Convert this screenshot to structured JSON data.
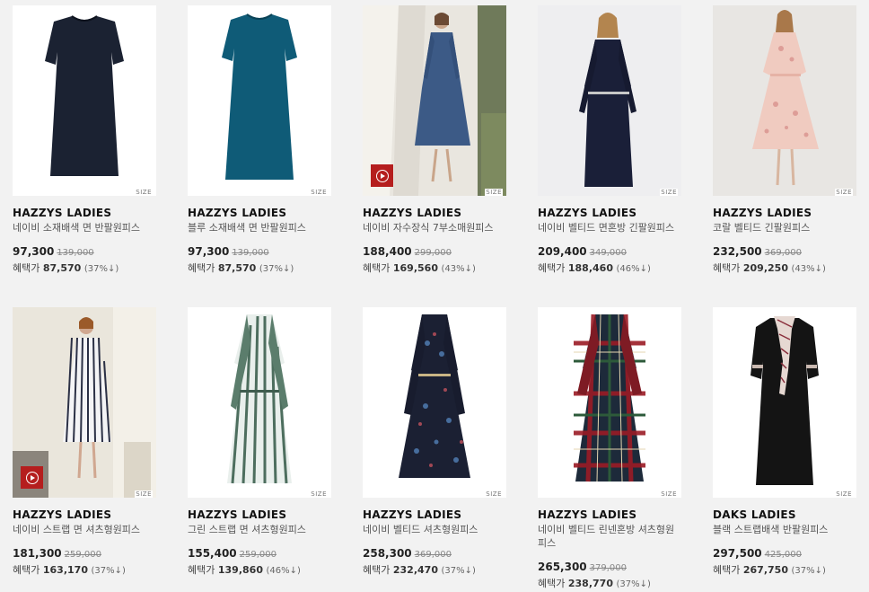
{
  "size_label": "SIZE",
  "benefit_label": "혜택가",
  "products": [
    {
      "brand": "HAZZYS LADIES",
      "name": "네이비 소재배색 면 반팔원피스",
      "price": "97,300",
      "original_price": "139,000",
      "benefit_price": "87,570",
      "discount": "(37%↓)",
      "video": false,
      "image": "navy-short-sleeve-dress"
    },
    {
      "brand": "HAZZYS LADIES",
      "name": "블루 소재배색 면 반팔원피스",
      "price": "97,300",
      "original_price": "139,000",
      "benefit_price": "87,570",
      "discount": "(37%↓)",
      "video": false,
      "image": "teal-short-sleeve-dress"
    },
    {
      "brand": "HAZZYS LADIES",
      "name": "네이비 자수장식 7부소매원피스",
      "price": "188,400",
      "original_price": "299,000",
      "benefit_price": "169,560",
      "discount": "(43%↓)",
      "video": true,
      "image": "model-blue-dress-curtain"
    },
    {
      "brand": "HAZZYS LADIES",
      "name": "네이비 벨티드 면혼방 긴팔원피스",
      "price": "209,400",
      "original_price": "349,000",
      "benefit_price": "188,460",
      "discount": "(46%↓)",
      "video": false,
      "image": "model-navy-shirt-dress"
    },
    {
      "brand": "HAZZYS LADIES",
      "name": "코랄 벨티드 긴팔원피스",
      "price": "232,500",
      "original_price": "369,000",
      "benefit_price": "209,250",
      "discount": "(43%↓)",
      "video": false,
      "image": "model-floral-pink-dress"
    },
    {
      "brand": "HAZZYS LADIES",
      "name": "네이비 스트랩 면 셔츠형원피스",
      "price": "181,300",
      "original_price": "259,000",
      "benefit_price": "163,170",
      "discount": "(37%↓)",
      "video": true,
      "image": "model-striped-dress"
    },
    {
      "brand": "HAZZYS LADIES",
      "name": "그린 스트랩 면 셔츠형원피스",
      "price": "155,400",
      "original_price": "259,000",
      "benefit_price": "139,860",
      "discount": "(46%↓)",
      "video": false,
      "image": "green-striped-shirt-dress"
    },
    {
      "brand": "HAZZYS LADIES",
      "name": "네이비 벨티드 셔츠형원피스",
      "price": "258,300",
      "original_price": "369,000",
      "benefit_price": "232,470",
      "discount": "(37%↓)",
      "video": false,
      "image": "navy-floral-shirt-dress"
    },
    {
      "brand": "HAZZYS LADIES",
      "name": "네이비 벨티드 린넨혼방 셔츠형원피스",
      "price": "265,300",
      "original_price": "379,000",
      "benefit_price": "238,770",
      "discount": "(37%↓)",
      "video": false,
      "image": "plaid-shirt-dress"
    },
    {
      "brand": "DAKS LADIES",
      "name": "블랙 스트랩배색 반팔원피스",
      "price": "297,500",
      "original_price": "425,000",
      "benefit_price": "267,750",
      "discount": "(37%↓)",
      "video": false,
      "image": "black-dress-scarf"
    }
  ]
}
